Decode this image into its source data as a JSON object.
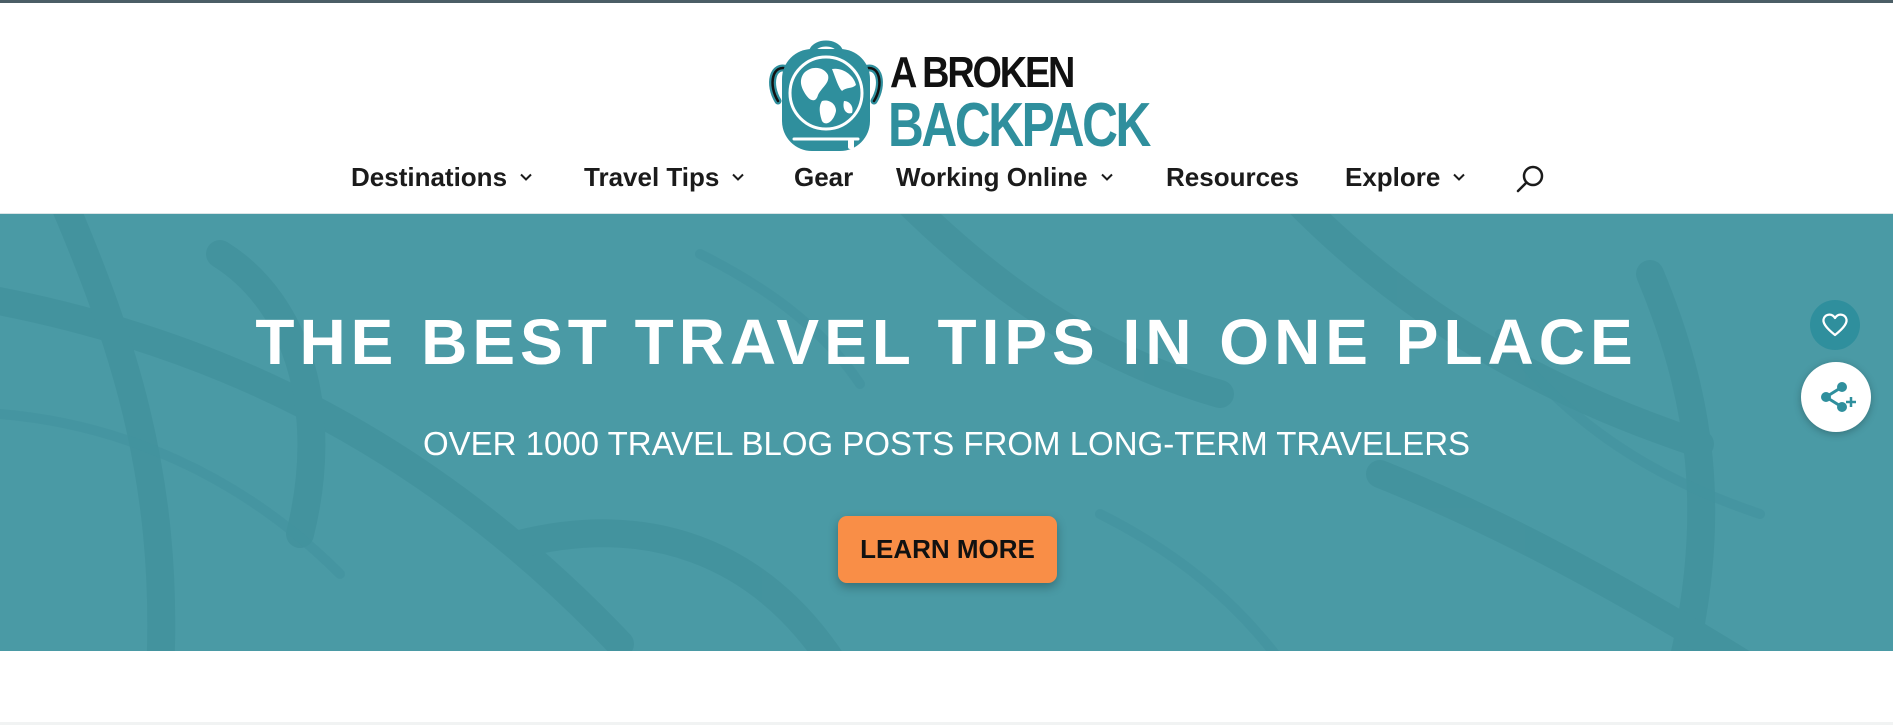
{
  "site": {
    "logo_line1": "A BROKEN",
    "logo_line2": "BACKPACK"
  },
  "nav": {
    "items": [
      {
        "label": "Destinations",
        "has_dropdown": true
      },
      {
        "label": "Travel Tips",
        "has_dropdown": true
      },
      {
        "label": "Gear",
        "has_dropdown": false
      },
      {
        "label": "Working Online",
        "has_dropdown": true
      },
      {
        "label": "Resources",
        "has_dropdown": false
      },
      {
        "label": "Explore",
        "has_dropdown": true
      }
    ],
    "search_icon": "search-icon"
  },
  "hero": {
    "title": "THE BEST TRAVEL TIPS IN ONE PLACE",
    "subtitle": "OVER 1000 TRAVEL BLOG POSTS FROM LONG-TERM TRAVELERS",
    "cta_label": "LEARN MORE"
  },
  "floating": {
    "favorite_icon": "heart-icon",
    "share_icon": "share-icon"
  },
  "colors": {
    "brand_teal": "#2f8f9d",
    "hero_bg": "#4a9aa5",
    "cta_orange": "#f98e47",
    "nav_text": "#1b1b1b"
  }
}
